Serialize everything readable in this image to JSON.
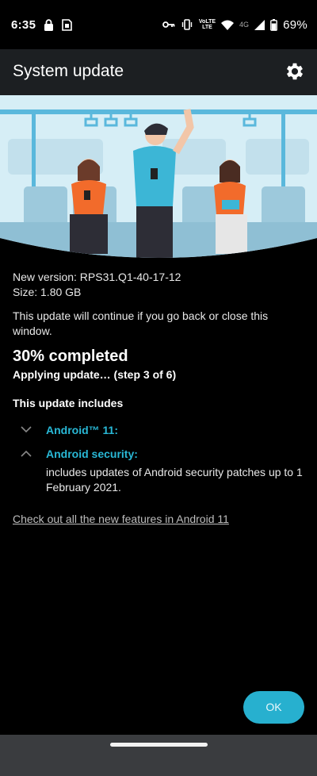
{
  "status_bar": {
    "time": "6:35",
    "net_label_top": "VoLTE",
    "net_label_bottom": "LTE",
    "net_type": "4G",
    "battery": "69%",
    "icons": [
      "lock-icon",
      "sim-manager-icon",
      "vpn-key-icon",
      "vibrate-icon",
      "wifi-icon",
      "signal-icon",
      "battery-icon"
    ]
  },
  "app_bar": {
    "title": "System update",
    "settings_icon": "gear-icon"
  },
  "update": {
    "version": "New version: RPS31.Q1-40-17-12",
    "size": "Size: 1.80 GB",
    "note": "This update will continue if you go back or close this window.",
    "progress_text": "30% completed",
    "progress": 0.3,
    "step_text": "Applying update… (step 3 of 6)",
    "includes_heading": "This update includes",
    "items": [
      {
        "title": "Android™ 11:",
        "expanded": false,
        "detail": ""
      },
      {
        "title": "Android security:",
        "expanded": true,
        "detail": "includes updates of Android security patches up to 1 February 2021."
      }
    ],
    "link": "Check out all the new features in Android 11"
  },
  "ok_button": "OK",
  "colors": {
    "accent": "#27b0cf",
    "appbar": "#1c1f22",
    "background": "#000000"
  }
}
